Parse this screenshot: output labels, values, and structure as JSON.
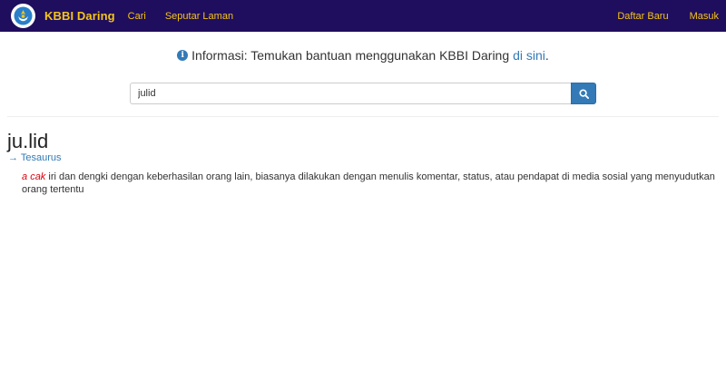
{
  "nav": {
    "brand": "KBBI Daring",
    "items": [
      "Cari",
      "Seputar Laman"
    ],
    "right_items": [
      "Daftar Baru",
      "Masuk"
    ]
  },
  "info": {
    "prefix": "Informasi: Temukan bantuan menggunakan KBBI Daring",
    "link": "di sini",
    "suffix": "."
  },
  "search": {
    "value": "julid"
  },
  "entry": {
    "title": "ju.lid",
    "tesaurus": "→ Tesaurus",
    "definition": {
      "labels": [
        "a",
        "cak"
      ],
      "text": "iri dan dengki dengan keberhasilan orang lain, biasanya dilakukan dengan menulis komentar, status, atau pendapat di media sosial yang menyudutkan orang tertentu"
    }
  },
  "colors": {
    "navbar_bg": "#1f0d5e",
    "nav_text": "#f5c518",
    "link": "#337ab7",
    "label": "#d9000d"
  },
  "icons": {
    "logo": "tut-wuri-handayani-logo",
    "info": "info-circle-icon",
    "search": "search-icon"
  }
}
